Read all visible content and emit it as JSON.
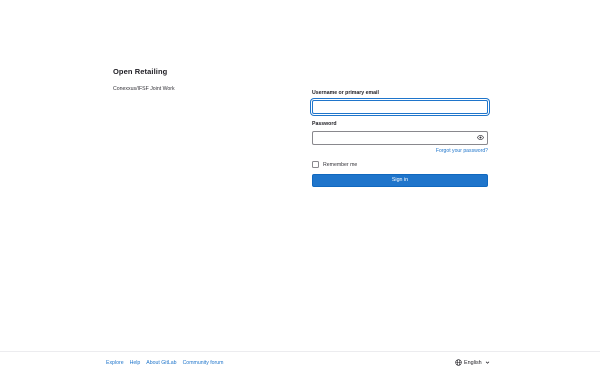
{
  "brand": {
    "title": "Open Retailing",
    "description": "Conexxus/IFSF Joint Work"
  },
  "form": {
    "username_label": "Username or primary email",
    "username_value": "",
    "password_label": "Password",
    "password_value": "",
    "forgot_password": "Forgot your password?",
    "remember_me": "Remember me",
    "remember_me_checked": false,
    "sign_in": "Sign in"
  },
  "footer": {
    "links": [
      "Explore",
      "Help",
      "About GitLab",
      "Community forum"
    ],
    "language": "English"
  },
  "icons": {
    "password_toggle": "eye-icon",
    "language": "globe-icon",
    "language_menu": "chevron-down-icon"
  },
  "colors": {
    "accent": "#1f75cb",
    "text": "#333238",
    "border": "#89888d"
  }
}
